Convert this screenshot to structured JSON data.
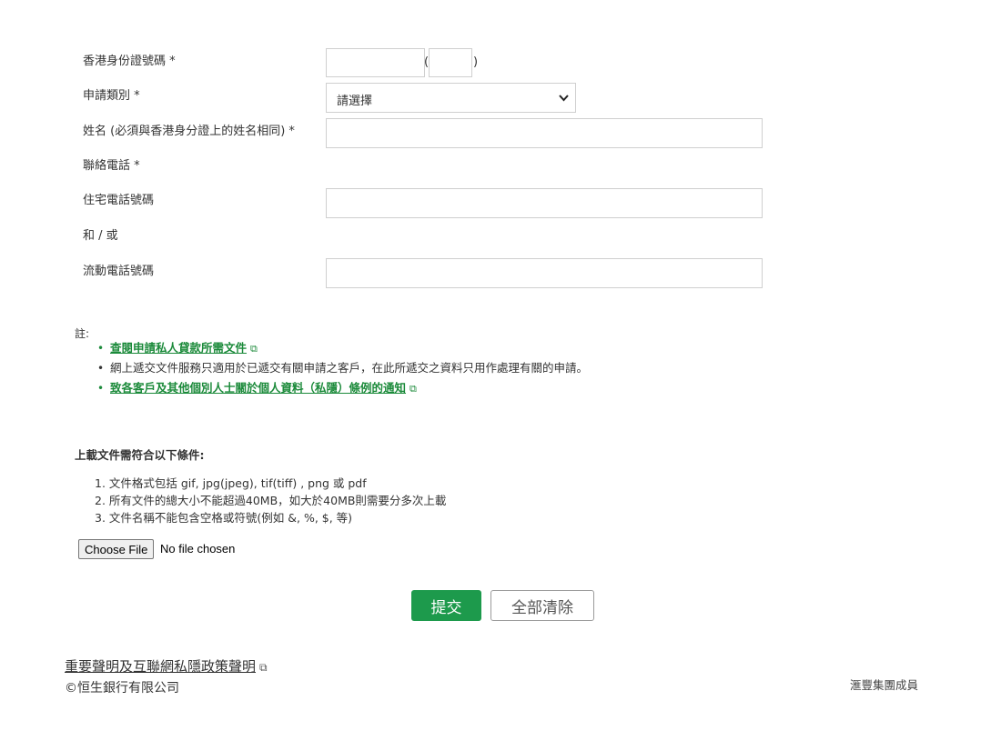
{
  "form": {
    "hkid_label": "香港身份證號碼 *",
    "hkid_open_paren": "(",
    "hkid_close_paren": ")",
    "hkid_value": "",
    "hkid_check_value": "",
    "category_label": "申請類別 *",
    "category_selected": "請選擇",
    "name_label": "姓名 (必須與香港身分證上的姓名相同) *",
    "name_value": "",
    "contact_label": "聯絡電話 *",
    "home_phone_label": "住宅電話號碼",
    "home_phone_value": "",
    "and_or": "和 / 或",
    "mobile_label": "流動電話號碼",
    "mobile_value": ""
  },
  "notes": {
    "title": "註:",
    "items": [
      {
        "text": "查閱申請私人貸款所需文件",
        "link": true
      },
      {
        "text": "網上遞交文件服務只適用於已遞交有關申請之客戶，在此所遞交之資料只用作處理有關的申請。",
        "link": false
      },
      {
        "text": "致各客戶及其他個別人士關於個人資料（私隱）條例的通知",
        "link": true
      }
    ]
  },
  "upload": {
    "title": "上載文件需符合以下條件:",
    "conditions": [
      "1. 文件格式包括 gif, jpg(jpeg), tif(tiff) , png 或 pdf",
      "2. 所有文件的總大小不能超過40MB，如大於40MB則需要分多次上載",
      "3. 文件名稱不能包含空格或符號(例如 &, %, $, 等)"
    ],
    "choose_file_label": "Choose File",
    "file_status": "No file chosen"
  },
  "actions": {
    "submit_label": "提交",
    "clear_label": "全部清除"
  },
  "footer": {
    "disclaimer_link": "重要聲明及互聯網私隱政策聲明",
    "copyright": "©恒生銀行有限公司",
    "member": "滙豐集團成員"
  },
  "colors": {
    "accent_green": "#1d9a4c",
    "link_green": "#1b8a3a"
  },
  "icons": {
    "external_link": "external-link-icon",
    "dropdown": "chevron-down-icon"
  }
}
